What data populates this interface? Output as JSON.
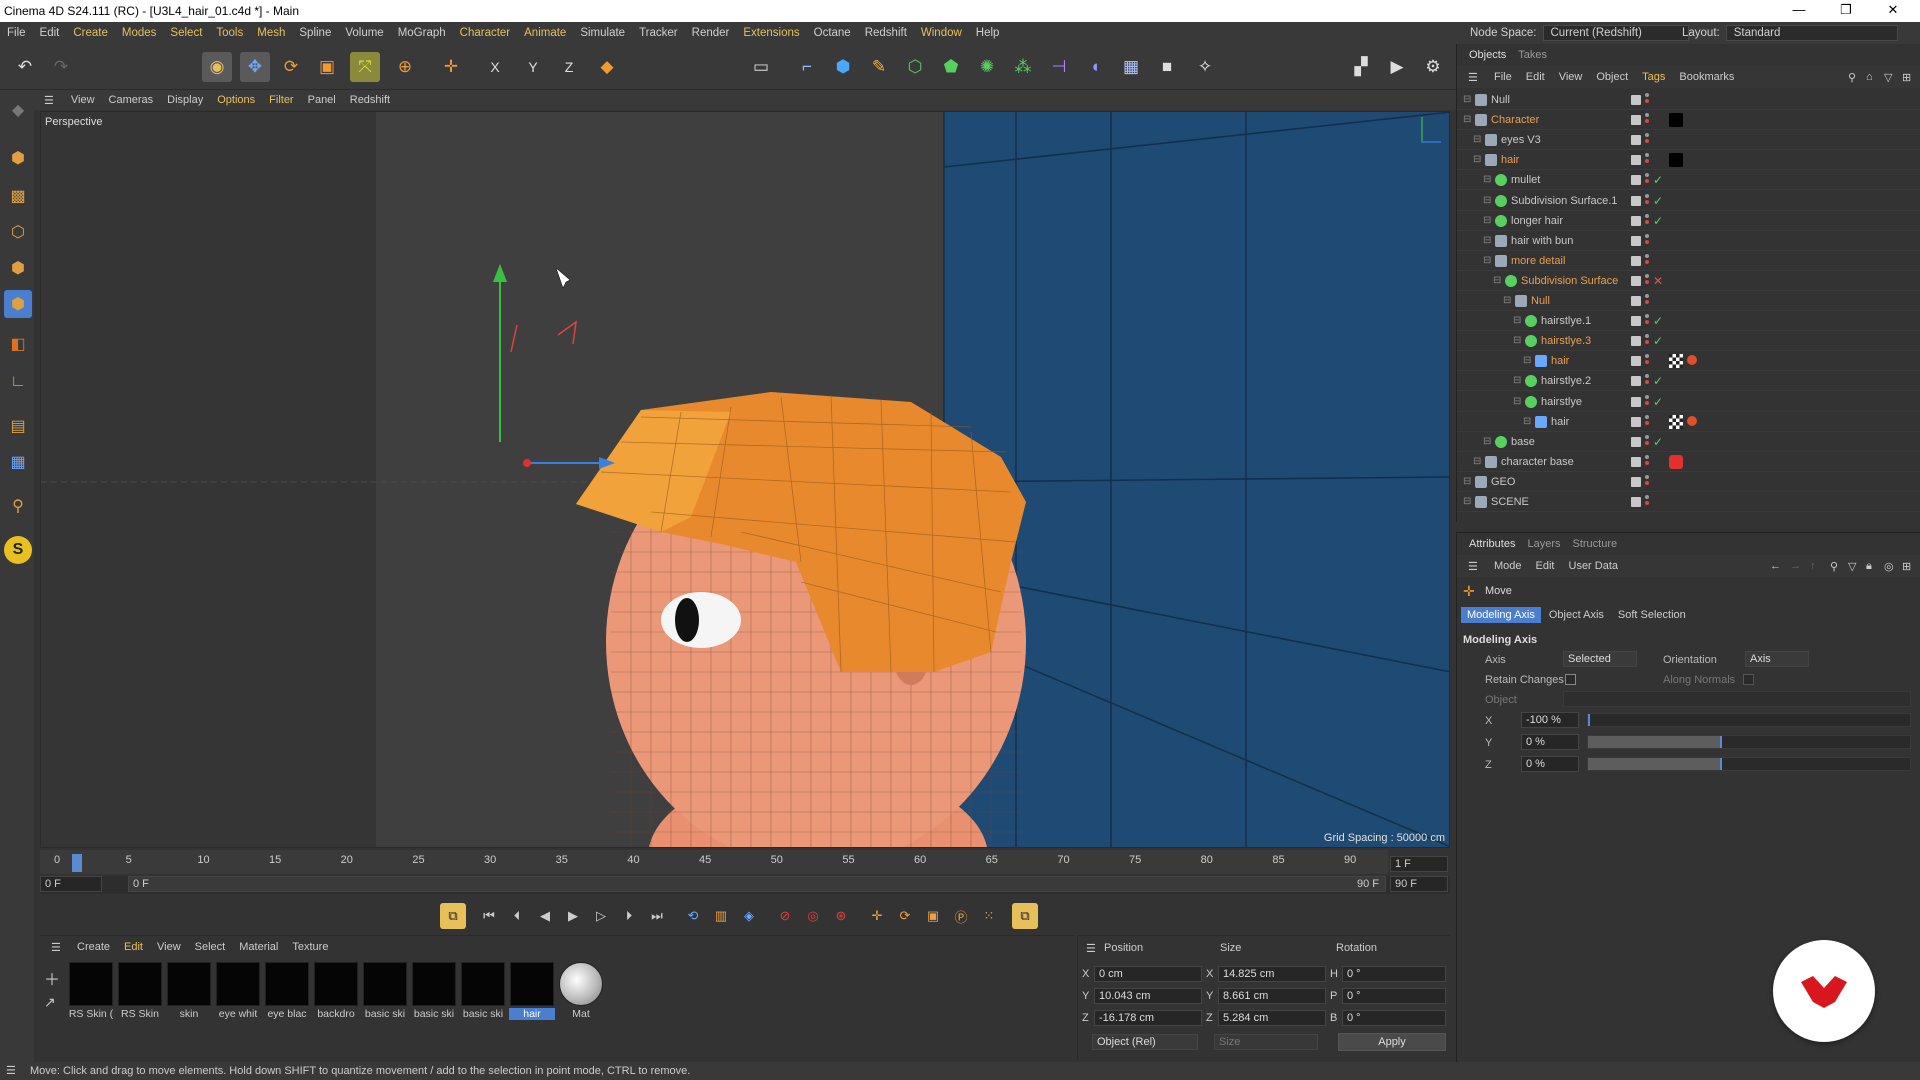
{
  "window": {
    "title": "Cinema 4D S24.111 (RC) - [U3L4_hair_01.c4d *] - Main",
    "minimize": "—",
    "maximize": "❐",
    "close": "✕"
  },
  "menubar": {
    "items": [
      "File",
      "Edit",
      "Create",
      "Modes",
      "Select",
      "Tools",
      "Mesh",
      "Spline",
      "Volume",
      "MoGraph",
      "Character",
      "Animate",
      "Simulate",
      "Tracker",
      "Render",
      "Extensions",
      "Octane",
      "Redshift",
      "Window",
      "Help"
    ],
    "node_space_label": "Node Space:",
    "node_space_value": "Current (Redshift)",
    "layout_label": "Layout:",
    "layout_value": "Standard"
  },
  "viewport_menu": {
    "items": [
      "View",
      "Cameras",
      "Display",
      "Options",
      "Filter",
      "Panel",
      "Redshift"
    ]
  },
  "viewport": {
    "label": "Perspective",
    "grid_spacing": "Grid Spacing : 50000 cm"
  },
  "timeline": {
    "ticks": [
      "0",
      "5",
      "10",
      "15",
      "20",
      "25",
      "30",
      "35",
      "40",
      "45",
      "50",
      "55",
      "60",
      "65",
      "70",
      "75",
      "80",
      "85",
      "90"
    ],
    "current_frame": "1 F",
    "start_frame": "0 F",
    "range_start": "0 F",
    "range_end": "90 F",
    "end_frame": "90 F"
  },
  "material_manager": {
    "menu": [
      "Create",
      "Edit",
      "View",
      "Select",
      "Material",
      "Texture"
    ],
    "materials": [
      {
        "name": "RS Skin (",
        "selected": false
      },
      {
        "name": "RS Skin",
        "selected": false
      },
      {
        "name": "skin",
        "selected": false
      },
      {
        "name": "eye whit",
        "selected": false
      },
      {
        "name": "eye blac",
        "selected": false
      },
      {
        "name": "backdro",
        "selected": false
      },
      {
        "name": "basic ski",
        "selected": false
      },
      {
        "name": "basic ski",
        "selected": false
      },
      {
        "name": "basic ski",
        "selected": false
      },
      {
        "name": "hair",
        "selected": true
      },
      {
        "name": "Mat",
        "selected": false
      }
    ]
  },
  "coordinates": {
    "headers": {
      "position": "Position",
      "size": "Size",
      "rotation": "Rotation"
    },
    "rows": [
      {
        "axis": "X",
        "pos": "0 cm",
        "size_axis": "X",
        "size": "14.825 cm",
        "rot_axis": "H",
        "rot": "0 °"
      },
      {
        "axis": "Y",
        "pos": "10.043 cm",
        "size_axis": "Y",
        "size": "8.661 cm",
        "rot_axis": "P",
        "rot": "0 °"
      },
      {
        "axis": "Z",
        "pos": "-16.178 cm",
        "size_axis": "Z",
        "size": "5.284 cm",
        "rot_axis": "B",
        "rot": "0 °"
      }
    ],
    "mode": "Object (Rel)",
    "size_mode": "Size",
    "apply": "Apply"
  },
  "status": "Move: Click and drag to move elements. Hold down SHIFT to quantize movement / add to the selection in point mode, CTRL to remove.",
  "object_manager": {
    "tabs": [
      "Objects",
      "Takes"
    ],
    "menu": [
      "File",
      "Edit",
      "View",
      "Object",
      "Tags",
      "Bookmarks"
    ],
    "rows": [
      {
        "name": "Null",
        "indent": 0,
        "hl": false,
        "icon": "null",
        "check": ""
      },
      {
        "name": "Character",
        "indent": 0,
        "hl": true,
        "icon": "null",
        "check": "",
        "tag": "black"
      },
      {
        "name": "eyes V3",
        "indent": 1,
        "hl": false,
        "icon": "null",
        "check": ""
      },
      {
        "name": "hair",
        "indent": 1,
        "hl": true,
        "icon": "null",
        "check": "",
        "tag": "black"
      },
      {
        "name": "mullet",
        "indent": 2,
        "hl": false,
        "icon": "gen",
        "check": "✓"
      },
      {
        "name": "Subdivision Surface.1",
        "indent": 2,
        "hl": false,
        "icon": "gen",
        "check": "✓"
      },
      {
        "name": "longer hair",
        "indent": 2,
        "hl": false,
        "icon": "gen",
        "check": "✓"
      },
      {
        "name": "hair with bun",
        "indent": 2,
        "hl": false,
        "icon": "null",
        "check": ""
      },
      {
        "name": "more detail",
        "indent": 2,
        "hl": true,
        "icon": "null",
        "check": ""
      },
      {
        "name": "Subdivision Surface",
        "indent": 3,
        "hl": true,
        "icon": "gen",
        "check": "✕"
      },
      {
        "name": "Null",
        "indent": 4,
        "hl": true,
        "icon": "null",
        "check": ""
      },
      {
        "name": "hairstlye.1",
        "indent": 5,
        "hl": false,
        "icon": "obj",
        "check": "✓"
      },
      {
        "name": "hairstlye.3",
        "indent": 5,
        "hl": true,
        "icon": "obj",
        "check": "✓"
      },
      {
        "name": "hair",
        "indent": 6,
        "hl": true,
        "icon": "joint",
        "check": "",
        "tag": "checker"
      },
      {
        "name": "hairstlye.2",
        "indent": 5,
        "hl": false,
        "icon": "obj",
        "check": "✓"
      },
      {
        "name": "hairstlye",
        "indent": 5,
        "hl": false,
        "icon": "obj",
        "check": "✓"
      },
      {
        "name": "hair",
        "indent": 6,
        "hl": false,
        "icon": "joint",
        "check": "",
        "tag": "checker"
      },
      {
        "name": "base",
        "indent": 2,
        "hl": false,
        "icon": "gen",
        "check": "✓"
      },
      {
        "name": "character base",
        "indent": 1,
        "hl": false,
        "icon": "null",
        "check": "",
        "tag": "red"
      },
      {
        "name": "GEO",
        "indent": 0,
        "hl": false,
        "icon": "null",
        "check": ""
      },
      {
        "name": "SCENE",
        "indent": 0,
        "hl": false,
        "icon": "null",
        "check": ""
      }
    ]
  },
  "attributes": {
    "tabs": [
      "Attributes",
      "Layers",
      "Structure"
    ],
    "mode_menu": [
      "Mode",
      "Edit",
      "User Data"
    ],
    "tool": "Move",
    "subtabs": [
      "Modeling Axis",
      "Object Axis",
      "Soft Selection"
    ],
    "section": "Modeling Axis",
    "axis_label": "Axis",
    "axis_value": "Selected",
    "orientation_label": "Orientation",
    "orientation_value": "Axis",
    "retain_label": "Retain Changes",
    "normals_label": "Along Normals",
    "object_label": "Object",
    "x_label": "X",
    "x_value": "-100 %",
    "x_level": -1.0,
    "y_label": "Y",
    "y_value": "0 %",
    "y_level": 0.0,
    "z_label": "Z",
    "z_value": "0 %",
    "z_level": 0.0
  },
  "colors": {
    "accent": "#e8c05a",
    "selected": "#4a7fd0",
    "hair": "#e8892e",
    "skin": "#e89a7a",
    "backdrop": "#1e4a72"
  }
}
